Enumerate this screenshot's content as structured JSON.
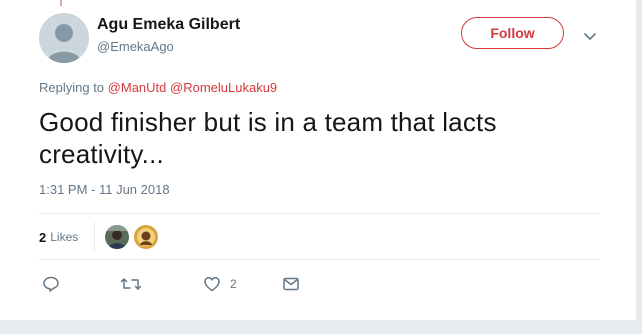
{
  "author": {
    "display_name": "Agu Emeka Gilbert",
    "handle": "@EmekaAgo"
  },
  "follow_button": {
    "label": "Follow"
  },
  "reply_context": {
    "prefix": "Replying to",
    "mentions": [
      "@ManUtd",
      "@RomeluLukaku9"
    ]
  },
  "tweet": {
    "text": "Good finisher but is in a team that lacts creativity...",
    "timestamp": "1:31 PM - 11 Jun 2018"
  },
  "stats": {
    "likes_count": "2",
    "likes_label": "Likes"
  },
  "actions": {
    "reply_count": "",
    "retweet_count": "",
    "like_count": "2",
    "dm_count": ""
  },
  "colors": {
    "accent": "#d6393b",
    "muted": "#657786",
    "text": "#14171a",
    "border": "#e6ecf0",
    "background": "#e6ecf0"
  },
  "icons": [
    "caret-down-icon",
    "reply-icon",
    "retweet-icon",
    "heart-icon",
    "envelope-icon"
  ]
}
